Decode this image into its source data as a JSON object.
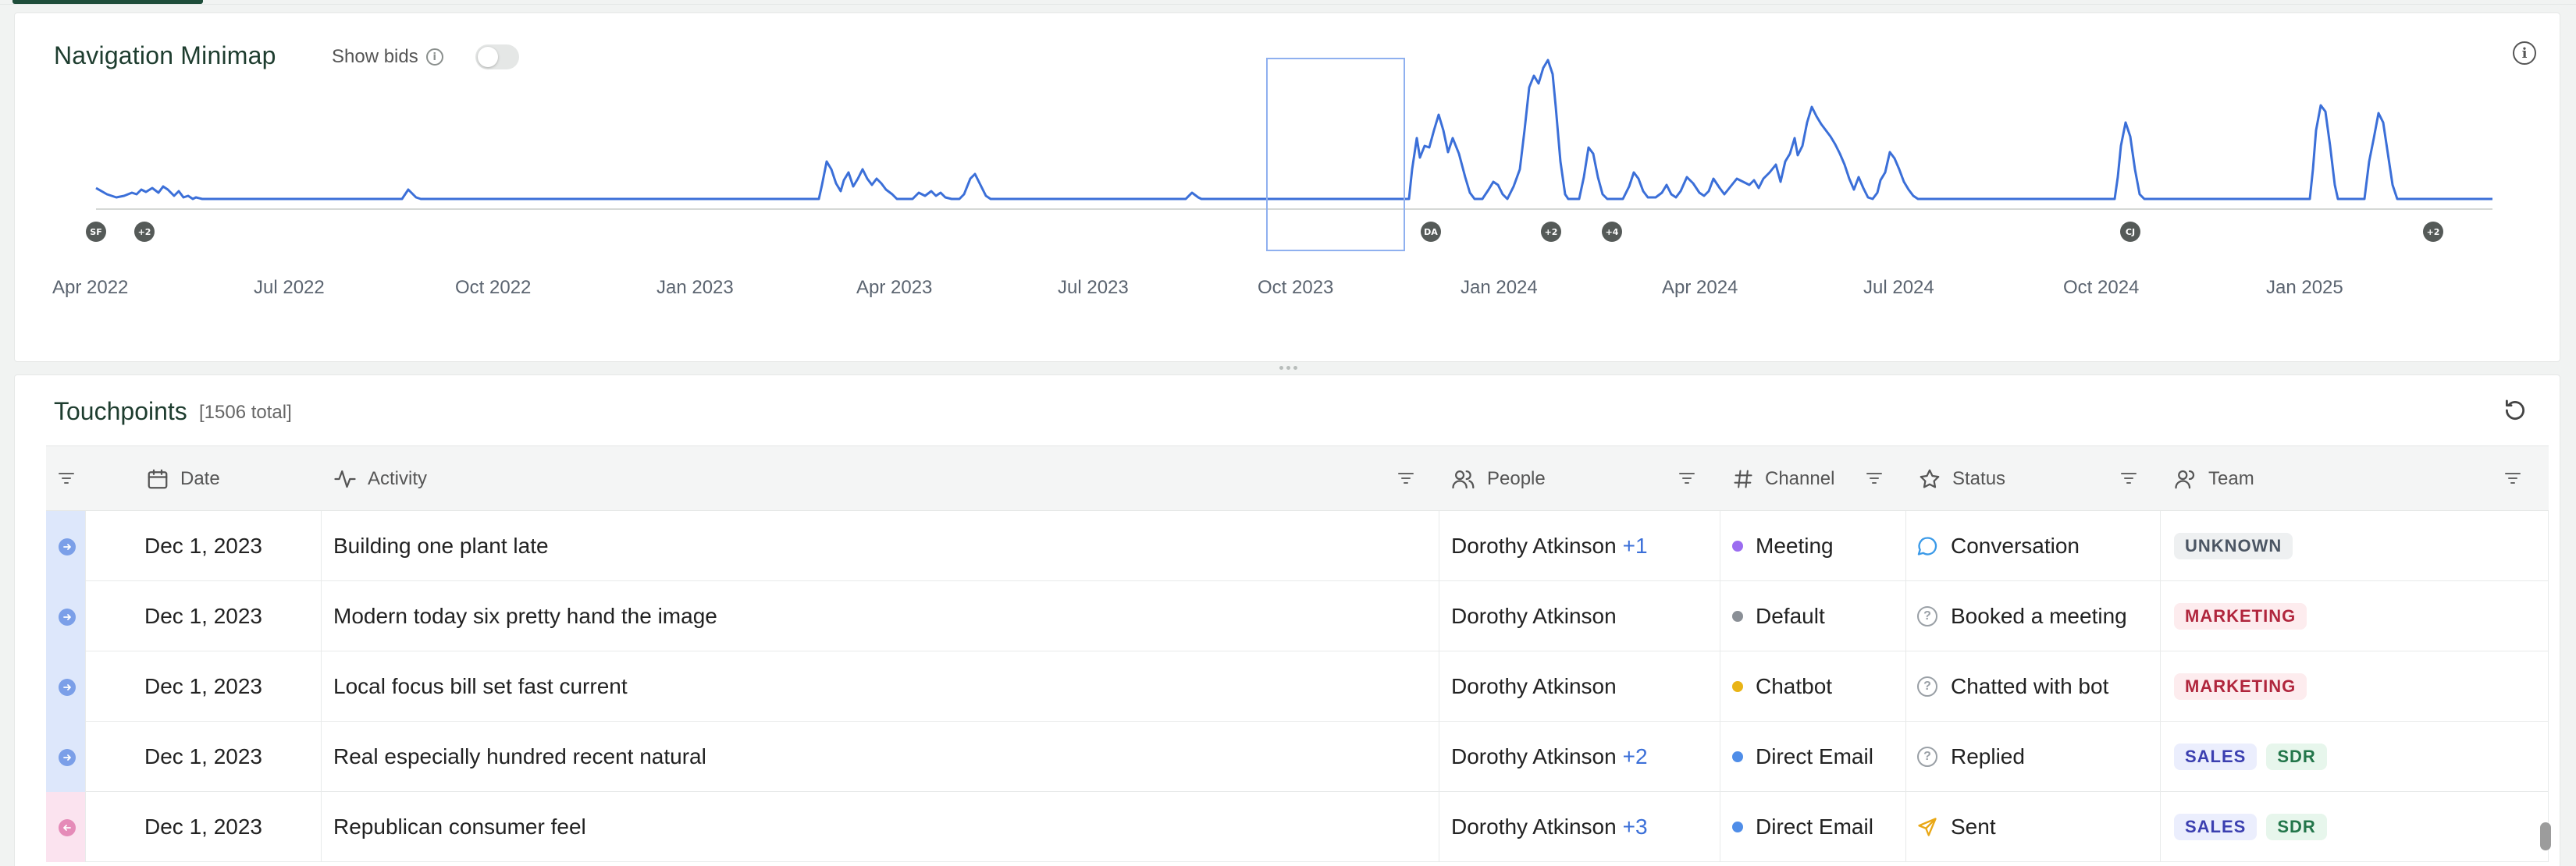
{
  "minimap": {
    "title": "Navigation Minimap",
    "show_bids_label": "Show bids",
    "show_bids_enabled": false,
    "months": [
      "Apr 2022",
      "Jul 2022",
      "Oct 2022",
      "Jan 2023",
      "Apr 2023",
      "Jul 2023",
      "Oct 2023",
      "Jan 2024",
      "Apr 2024",
      "Jul 2024",
      "Oct 2024",
      "Jan 2025"
    ],
    "markers": [
      "SF",
      "+2",
      "DA",
      "+2",
      "+4",
      "CJ",
      "+2"
    ],
    "line_color": "#3b6fd8"
  },
  "touchpoints": {
    "title": "Touchpoints",
    "count": "[1506 total]",
    "columns": {
      "date": "Date",
      "activity": "Activity",
      "people": "People",
      "channel": "Channel",
      "status": "Status",
      "team": "Team"
    },
    "rows": [
      {
        "date": "Dec 1, 2023",
        "activity": "Building one plant late",
        "person": "Dorothy Atkinson",
        "extra": "+1",
        "channel": "Meeting",
        "channel_color": "#9b6cf0",
        "status": "Conversation",
        "status_icon": "chat-bubble-icon",
        "teams": [
          "UNKNOWN"
        ],
        "direction": "inbound"
      },
      {
        "date": "Dec 1, 2023",
        "activity": "Modern today six pretty hand the image",
        "person": "Dorothy Atkinson",
        "extra": "",
        "channel": "Default",
        "channel_color": "#8a8f96",
        "status": "Booked a meeting",
        "status_icon": "question-icon",
        "teams": [
          "MARKETING"
        ],
        "direction": "inbound"
      },
      {
        "date": "Dec 1, 2023",
        "activity": "Local focus bill set fast current",
        "person": "Dorothy Atkinson",
        "extra": "",
        "channel": "Chatbot",
        "channel_color": "#e9b416",
        "status": "Chatted with bot",
        "status_icon": "question-icon",
        "teams": [
          "MARKETING"
        ],
        "direction": "inbound"
      },
      {
        "date": "Dec 1, 2023",
        "activity": "Real especially hundred recent natural",
        "person": "Dorothy Atkinson",
        "extra": "+2",
        "channel": "Direct Email",
        "channel_color": "#4f8de8",
        "status": "Replied",
        "status_icon": "question-icon",
        "teams": [
          "SALES",
          "SDR"
        ],
        "direction": "inbound"
      },
      {
        "date": "Dec 1, 2023",
        "activity": "Republican consumer feel",
        "person": "Dorothy Atkinson",
        "extra": "+3",
        "channel": "Direct Email",
        "channel_color": "#4f8de8",
        "status": "Sent",
        "status_icon": "send-icon",
        "teams": [
          "SALES",
          "SDR"
        ],
        "direction": "outbound"
      }
    ]
  }
}
